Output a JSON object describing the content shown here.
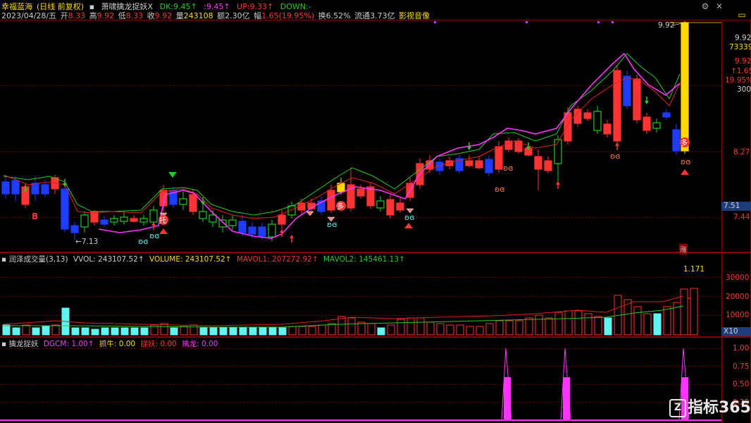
{
  "stock": {
    "name": "幸福蓝海",
    "mode": "(日线 前复权)",
    "indicator": "萧啸擒龙捉妖X",
    "date": "2023/04/28/五",
    "open_label": "开",
    "open": "8.33",
    "high_label": "高",
    "high": "9.92",
    "low_label": "低",
    "low": "8.33",
    "close_label": "收",
    "close": "9.92",
    "vol_label": "量",
    "vol": "243108",
    "amount_label": "额",
    "amount": "2.30亿",
    "change_label": "幅",
    "change": "1.65(19.95%)",
    "turnover_label": "换",
    "turnover": "6.52%",
    "float_label": "流通",
    "float": "3.73亿",
    "video": "影视音像"
  },
  "indicator_values": {
    "dk_label": "DK:",
    "dk": "9.45↑",
    "blank_label": ":",
    "blank": "9.45↑",
    "up_label": "UP:",
    "up": "9.33↑",
    "down_label": "DOWN:",
    "down": "-"
  },
  "price_axis": {
    "top_marker": "9.92",
    "v1": "9.92",
    "v2": "73339",
    "v3": "9.92",
    "v4": "↑1.65",
    "v5": "19.95%",
    "v6": "300",
    "mid": "8.27",
    "box": "7.51",
    "low": "7.44",
    "chart_high": "9.92",
    "chart_low": "7.13"
  },
  "price_markers": {
    "b": "B",
    "tuo": "托",
    "duo1": "多",
    "duo2": "多",
    "zhang": "涨"
  },
  "volume": {
    "title": "润泽成交量",
    "params": "(3,13)",
    "vvol_label": "VVOL:",
    "vvol": "243107.52↑",
    "volume_label": "VOLUME:",
    "volume": "243107.52↑",
    "mavol1_label": "MAVOL1:",
    "mavol1": "207272.92↑",
    "mavol2_label": "MAVOL2:",
    "mavol2": "145461.13↑",
    "ratio": "1.171",
    "axis": [
      "30000",
      "20000",
      "10000"
    ],
    "unit": "X10"
  },
  "dragon": {
    "title": "擒龙捉妖",
    "dgcm_label": "DGCM:",
    "dgcm": "1.00↑",
    "zn_label": "抓牛:",
    "zn": "0.00",
    "zy_label": "捉妖:",
    "zy": "0.00",
    "ql_label": "擒龙:",
    "ql": "0.00",
    "axis": [
      "1.00",
      "0.75",
      "0.50",
      "0.25"
    ]
  },
  "watermark": "指标365",
  "colors": {
    "up": "#ff3333",
    "down": "#1e3cff",
    "ma_green": "#22cc22",
    "ma_red": "#e02020",
    "magenta": "#ff33ff",
    "yellow": "#ffd800",
    "cyan": "#5ff5f0"
  }
}
